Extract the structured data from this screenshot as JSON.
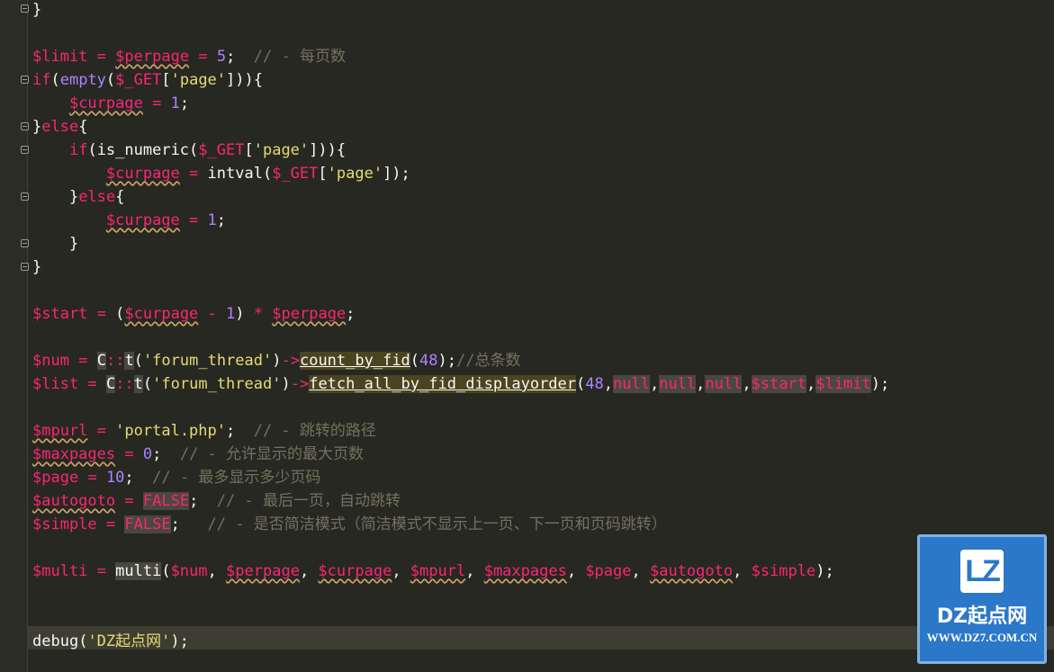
{
  "editor": {
    "language": "php",
    "theme_bg": "#272822"
  },
  "code": {
    "l1": "}",
    "l3_var1": "$limit",
    "l3_var2": "$perpage",
    "l3_num": "5",
    "l3_comment": "// - 每页数",
    "l4_if": "if",
    "l4_fn": "empty",
    "l4_get": "$_GET",
    "l4_str": "'page'",
    "l5_var": "$curpage",
    "l5_num": "1",
    "l6_else": "else",
    "l7_if": "if",
    "l7_fn": "is_numeric",
    "l7_get": "$_GET",
    "l7_str": "'page'",
    "l8_var": "$curpage",
    "l8_fn": "intval",
    "l8_get": "$_GET",
    "l8_str": "'page'",
    "l9_else": "else",
    "l10_var": "$curpage",
    "l10_num": "1",
    "l14_var": "$start",
    "l14_var2": "$curpage",
    "l14_num": "1",
    "l14_var3": "$perpage",
    "l16_var": "$num",
    "l16_cls": "C",
    "l16_t": "t",
    "l16_str": "'forum_thread'",
    "l16_meth": "count_by_fid",
    "l16_num": "48",
    "l16_comment": "//总条数",
    "l17_var": "$list",
    "l17_cls": "C",
    "l17_t": "t",
    "l17_str": "'forum_thread'",
    "l17_meth": "fetch_all_by_fid_displayorder",
    "l17_num": "48",
    "l17_null": "null",
    "l17_start": "$start",
    "l17_limit": "$limit",
    "l19_var": "$mpurl",
    "l19_str": "'portal.php'",
    "l19_comment": "// - 跳转的路径",
    "l20_var": "$maxpages",
    "l20_num": "0",
    "l20_comment": "// - 允许显示的最大页数",
    "l21_var": "$page",
    "l21_num": "10",
    "l21_comment": "// - 最多显示多少页码",
    "l22_var": "$autogoto",
    "l22_kw": "FALSE",
    "l22_comment": "// - 最后一页，自动跳转",
    "l23_var": "$simple",
    "l23_kw": "FALSE",
    "l23_comment": "// - 是否简洁模式（简洁模式不显示上一页、下一页和页码跳转）",
    "l25_var": "$multi",
    "l25_fn": "multi",
    "l25_a1": "$num",
    "l25_a2": "$perpage",
    "l25_a3": "$curpage",
    "l25_a4": "$mpurl",
    "l25_a5": "$maxpages",
    "l25_a6": "$page",
    "l25_a7": "$autogoto",
    "l25_a8": "$simple",
    "l28_fn": "debug",
    "l28_str": "'DZ起点网'"
  },
  "watermark": {
    "mark": "LZ",
    "name": "DZ起点网",
    "url": "WWW.DZ7.COM.CN"
  }
}
